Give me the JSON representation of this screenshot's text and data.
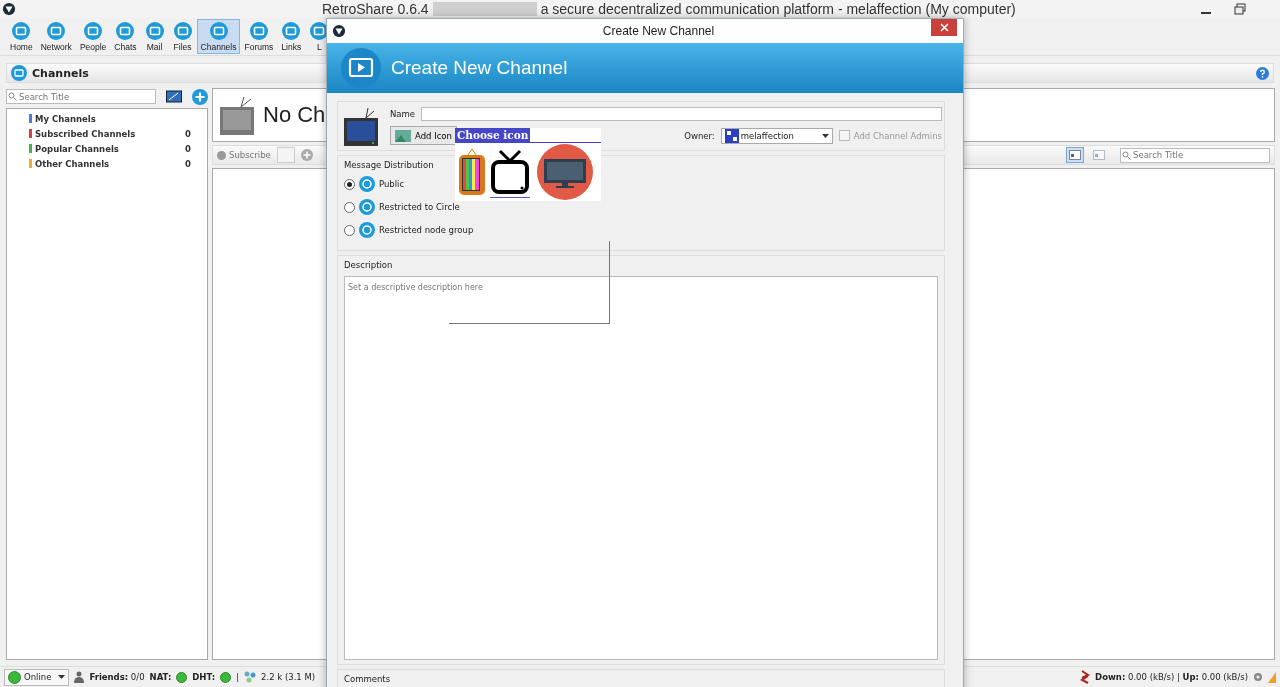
{
  "window": {
    "title_prefix": "RetroShare 0.6.4",
    "title_suffix": "a secure decentralized communication platform - melaffection (My computer)"
  },
  "toolbar": [
    {
      "label": "Home",
      "selected": false
    },
    {
      "label": "Network",
      "selected": false
    },
    {
      "label": "People",
      "selected": false
    },
    {
      "label": "Chats",
      "selected": false
    },
    {
      "label": "Mail",
      "selected": false
    },
    {
      "label": "Files",
      "selected": false
    },
    {
      "label": "Channels",
      "selected": true
    },
    {
      "label": "Forums",
      "selected": false
    },
    {
      "label": "Links",
      "selected": false
    },
    {
      "label": "L",
      "selected": false
    }
  ],
  "page_header": {
    "title": "Channels"
  },
  "sidebar": {
    "search_placeholder": "Search Title",
    "items": [
      {
        "label": "My Channels",
        "color": "#4a7fd0"
      },
      {
        "label": "Subscribed Channels",
        "count": "0",
        "color": "#d84040"
      },
      {
        "label": "Popular Channels",
        "count": "0",
        "color": "#4cae4c"
      },
      {
        "label": "Other Channels",
        "count": "0",
        "color": "#e8b030"
      }
    ]
  },
  "channel_view": {
    "heading": "No Ch",
    "subscribe": "Subscribe",
    "search_placeholder": "Search Title",
    "views": [
      {
        "selected": true
      },
      {
        "selected": false
      }
    ]
  },
  "dialog": {
    "title": "Create New Channel",
    "banner_title": "Create New Channel",
    "name_label": "Name",
    "add_icon": "Add Icon",
    "picker_title": "Choose icon",
    "picker_options": [
      {
        "kind": "retro",
        "selected": false
      },
      {
        "kind": "outline",
        "selected": true
      },
      {
        "kind": "flat",
        "selected": false
      }
    ],
    "owner_label": "Owner:",
    "owner": "melaffection",
    "admins": {
      "label": "Add Channel Admins",
      "checked": false,
      "disabled": true
    },
    "distribution_title": "Message Distribution",
    "distribution": [
      {
        "label": "Public",
        "selected": true
      },
      {
        "label": "Restricted to Circle",
        "selected": false
      },
      {
        "label": "Restricted node group",
        "selected": false
      }
    ],
    "description_title": "Description",
    "description_placeholder": "Set a descriptive description here",
    "comments_title": "Comments"
  },
  "status_bar": {
    "online": "Online",
    "friends": "**Friends:** 0/0",
    "nat": "NAT:",
    "dht": "DHT:",
    "separator": "|",
    "peers": "2.2 k (3.1 M)",
    "traffic": "**Down:** 0.00 (kB/s) | **Up:** 0.00 (kB/s)"
  }
}
